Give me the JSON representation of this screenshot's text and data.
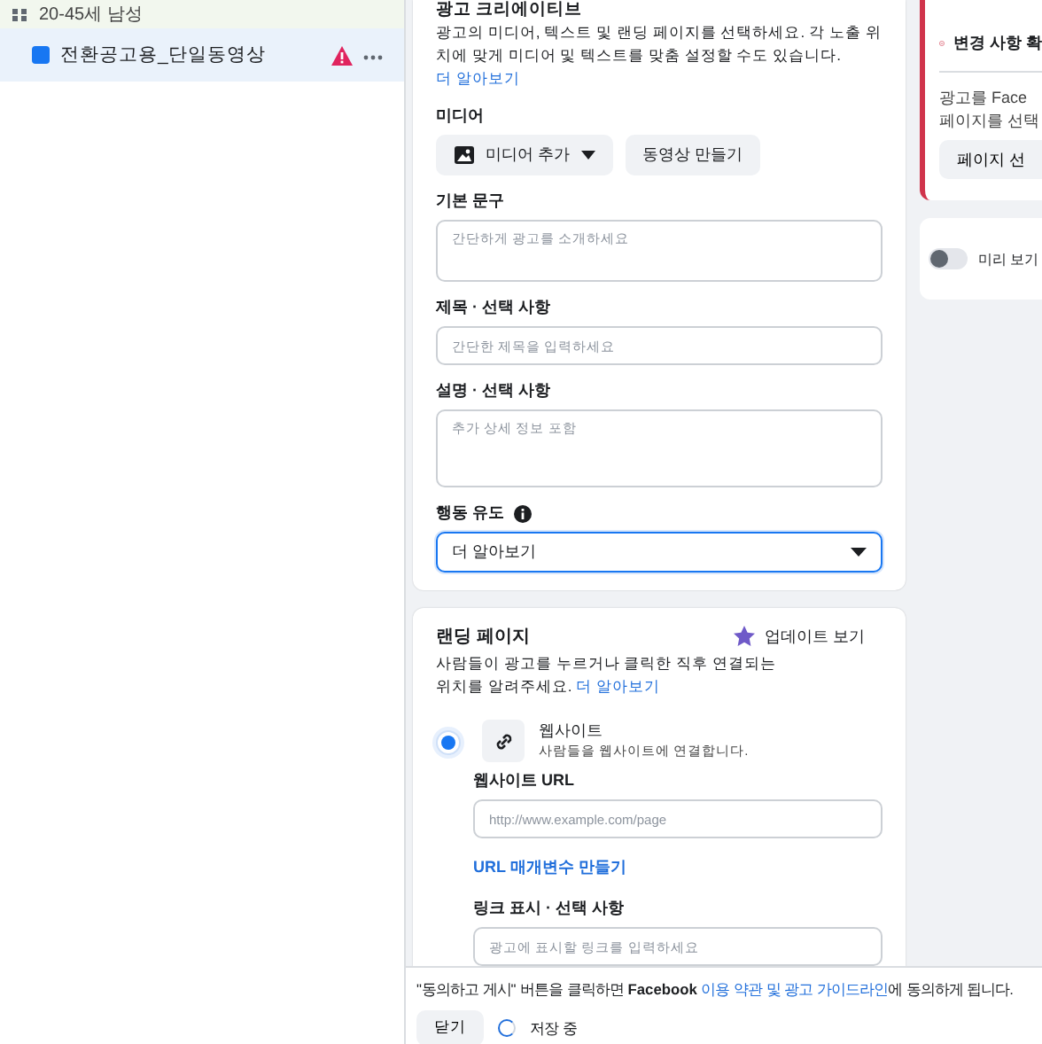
{
  "sidebar": {
    "ad_set": {
      "label": "20-45세 남성"
    },
    "items": [
      {
        "label": "전환공고용_단일동영상",
        "selected": true,
        "warning": true
      }
    ]
  },
  "creative": {
    "title": "광고 크리에이티브",
    "description": "광고의 미디어, 텍스트 및 랜딩 페이지를 선택하세요. 각 노출 위치에 맞게 미디어 및 텍스트를 맞춤 설정할 수도 있습니다.",
    "link": "더 알아보기",
    "fields": [
      {
        "kind": "media",
        "label": "미디어",
        "buttons": [
          "미디어 추가",
          "동영상 만들기"
        ]
      },
      {
        "kind": "textarea",
        "label": "기본 문구",
        "placeholder": "간단하게 광고를 소개하세요"
      },
      {
        "kind": "input",
        "label": "제목 · 선택 사항",
        "placeholder": "간단한 제목을 입력하세요"
      },
      {
        "kind": "textarea",
        "label": "설명 · 선택 사항",
        "placeholder": "추가 상세 정보 포함"
      },
      {
        "kind": "select",
        "label": "행동 유도",
        "value": "더 알아보기",
        "focused": true
      }
    ]
  },
  "landing": {
    "title": "랜딩 페이지",
    "update_button": "업데이트 보기",
    "description": "사람들이 광고를 누르거나 클릭한 직후 연결되는 위치를 알려주세요.",
    "link": "더 알아보기",
    "options": [
      {
        "title": "웹사이트",
        "subtitle": "사람들을 웹사이트에 연결합니다.",
        "selected": true
      }
    ],
    "fields": [
      {
        "kind": "input",
        "label": "웹사이트 URL",
        "placeholder": "http://www.example.com/page"
      },
      {
        "kind": "link",
        "label": "URL 매개변수 만들기"
      },
      {
        "kind": "input",
        "label": "링크 표시 · 선택 사항",
        "placeholder": "광고에 표시할 링크를 입력하세요"
      }
    ]
  },
  "side": {
    "alert": {
      "title": "변경 사항 확",
      "lines": [
        "광고를 Face",
        "페이지를 선택"
      ],
      "button": "페이지 선"
    },
    "preview": {
      "label": "미리 보기",
      "on": false
    }
  },
  "footer": {
    "notice": "\"동의하고 게시\" 버튼을 클릭하면 **Facebook**",
    "link": "이용 약관 및 광고 가이드라인",
    "notice_end": "에 동의하게 됩니다.",
    "close_button": "닫기",
    "status": "저장 중"
  }
}
